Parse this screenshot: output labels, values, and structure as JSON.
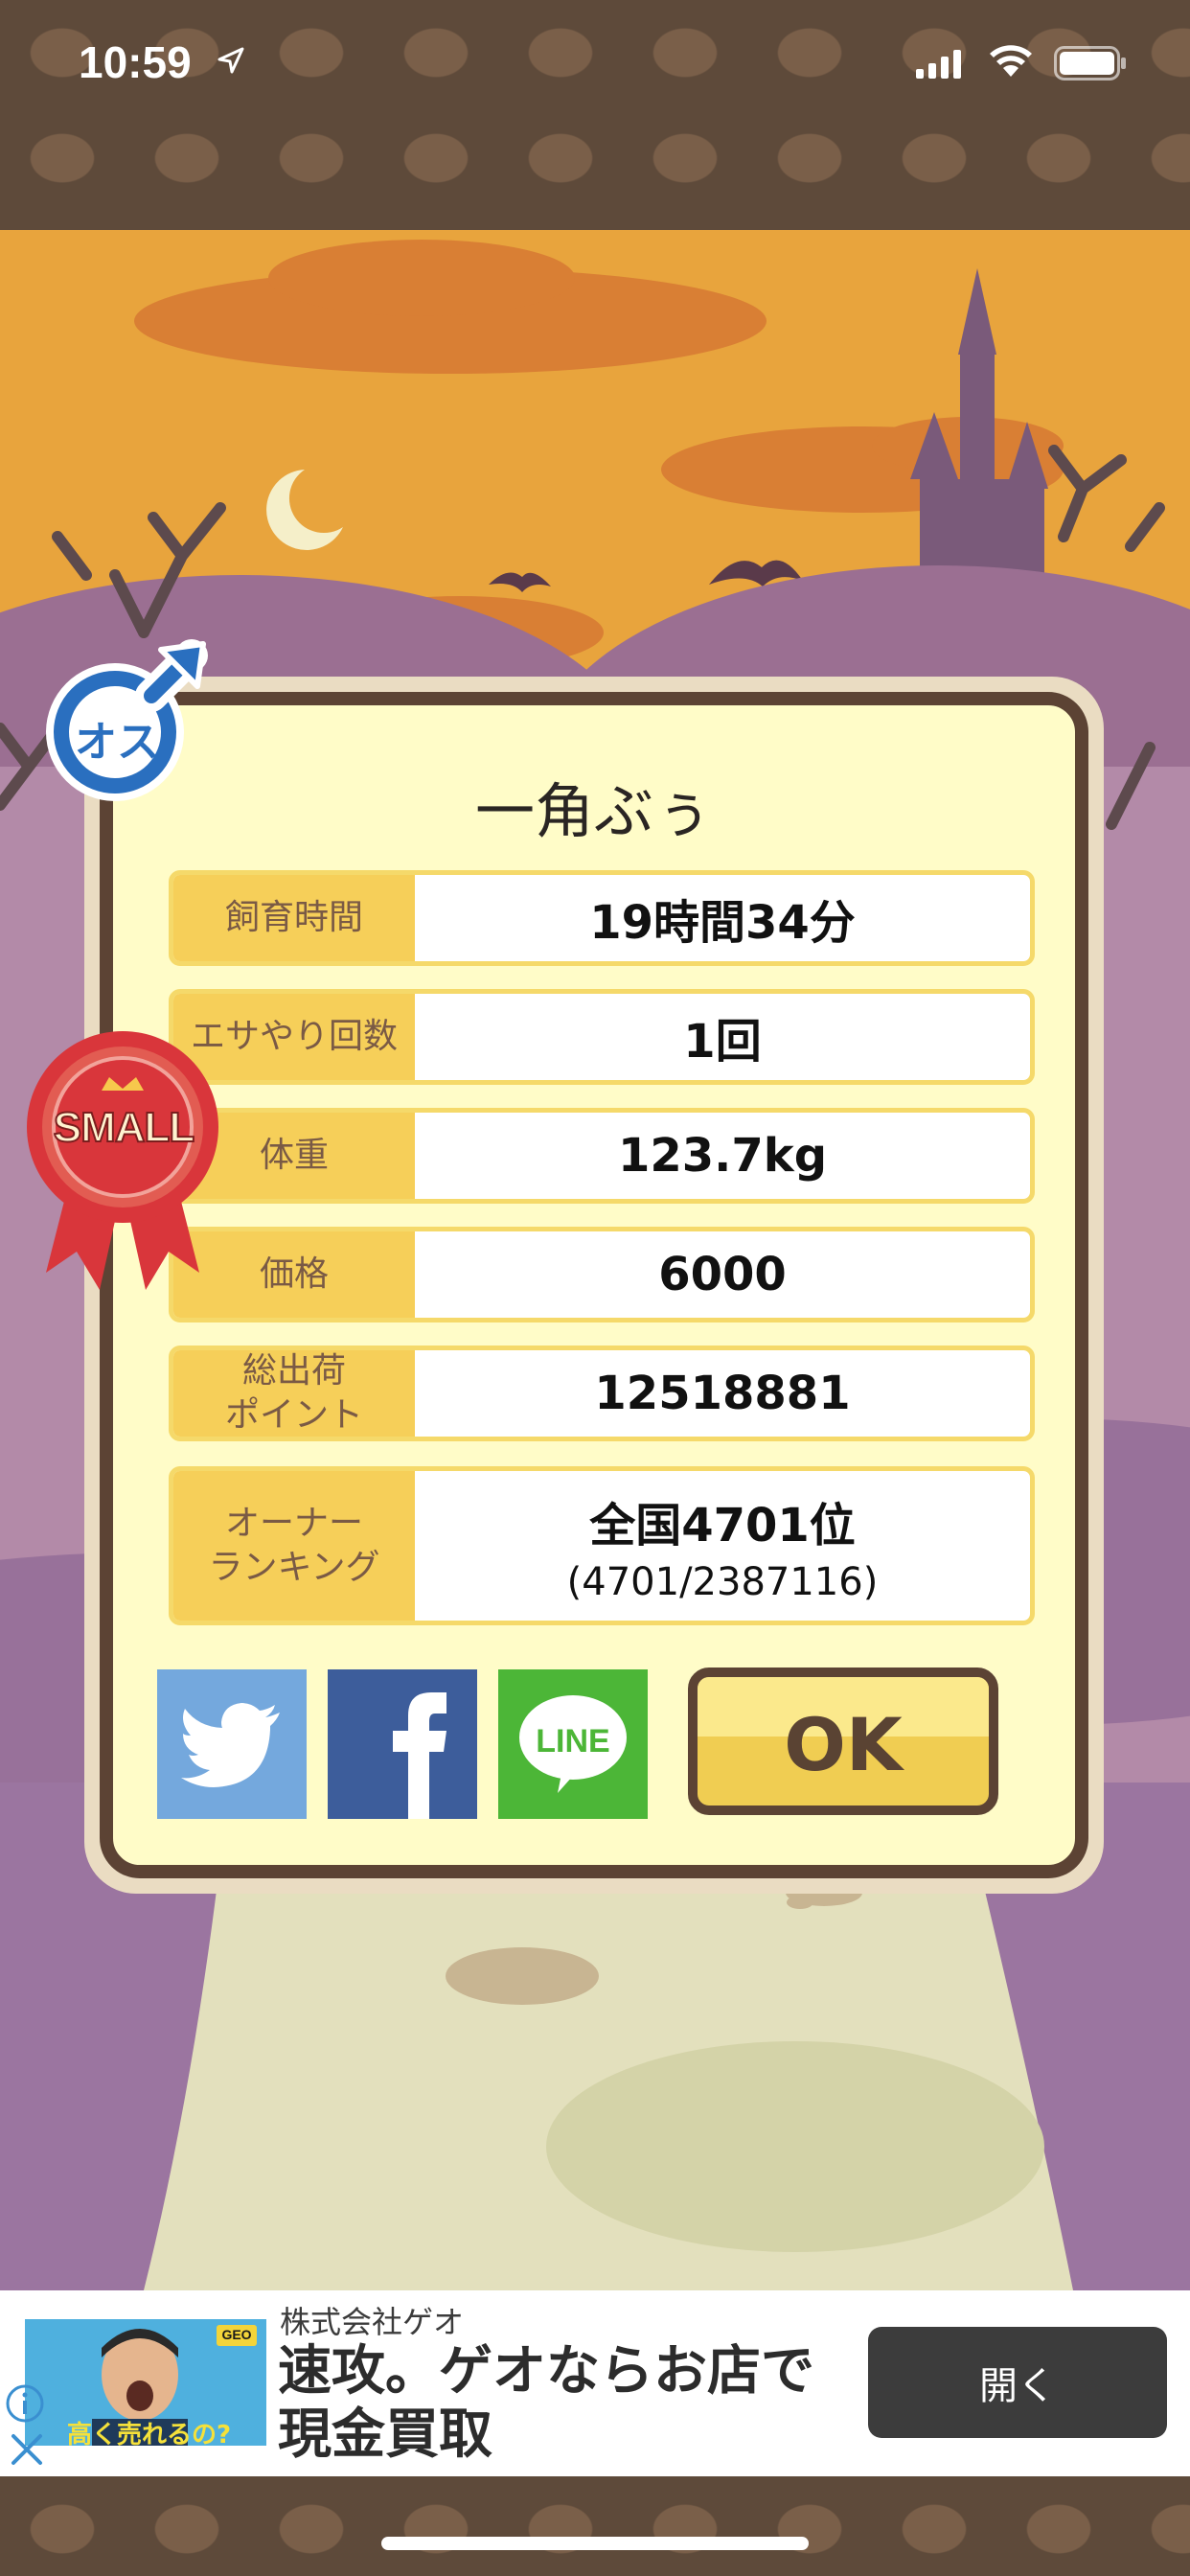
{
  "status_bar": {
    "time": "10:59"
  },
  "dialog": {
    "title": "一角ぶぅ",
    "rows": [
      {
        "label": "飼育時間",
        "value": "19時間34分"
      },
      {
        "label": "エサやり回数",
        "value": "1回"
      },
      {
        "label": "体重",
        "value": "123.7kg"
      },
      {
        "label": "価格",
        "value": "6000"
      },
      {
        "label": "総出荷\nポイント",
        "value": "12518881"
      },
      {
        "label": "オーナー\nランキング",
        "value": "全国4701位",
        "sub": "(4701/2387116)"
      }
    ],
    "share": {
      "line_label": "LINE"
    },
    "ok_label": "OK"
  },
  "badges": {
    "gender": "オス",
    "size": "SMALL"
  },
  "ad": {
    "sponsor": "株式会社ゲオ",
    "headline": "速攻。ゲオならお店で現金買取",
    "cta": "開く",
    "image_caption": "高く売れるの?",
    "image_tag": "GEO"
  },
  "colors": {
    "sky": "#e8a43d",
    "dialog_bg": "#fffcc8",
    "dialog_border": "#5c4334",
    "label_bg": "#f6cf59",
    "twitter": "#74a8dd",
    "facebook": "#3d5d9b",
    "line": "#4cb637",
    "ok_button": "#f0cd52"
  }
}
